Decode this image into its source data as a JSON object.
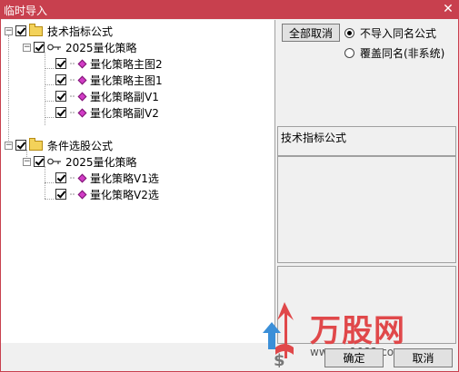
{
  "window": {
    "title": "临时导入",
    "close_glyph": "✕"
  },
  "tree": [
    {
      "id": "n1",
      "label": "技术指标公式",
      "type": "folder",
      "expander": "−",
      "checked": true
    },
    {
      "id": "n1a",
      "label": "2025量化策略",
      "type": "group",
      "expander": "−",
      "checked": true
    },
    {
      "id": "n1a1",
      "label": "量化策略主图2",
      "type": "formula",
      "checked": true
    },
    {
      "id": "n1a2",
      "label": "量化策略主图1",
      "type": "formula",
      "checked": true
    },
    {
      "id": "n1a3",
      "label": "量化策略副V1",
      "type": "formula",
      "checked": true
    },
    {
      "id": "n1a4",
      "label": "量化策略副V2",
      "type": "formula",
      "checked": true
    },
    {
      "id": "n2",
      "label": "条件选股公式",
      "type": "folder",
      "expander": "−",
      "checked": true
    },
    {
      "id": "n2a",
      "label": "2025量化策略",
      "type": "group",
      "expander": "−",
      "checked": true
    },
    {
      "id": "n2a1",
      "label": "量化策略V1选",
      "type": "formula",
      "checked": true
    },
    {
      "id": "n2a2",
      "label": "量化策略V2选",
      "type": "formula",
      "checked": true
    }
  ],
  "right": {
    "cancel_all_label": "全部取消",
    "options": [
      {
        "label": "不导入同名公式",
        "selected": true
      },
      {
        "label": "覆盖同名(非系统)",
        "selected": false
      }
    ],
    "formula_type_label": "技术指标公式"
  },
  "watermark": {
    "logo_text": "万股网",
    "site_text": "www.m1082.com"
  },
  "footer": {
    "confirm_label": "确定",
    "cancel_label": "取消"
  },
  "colors": {
    "titlebar": "#c8404e",
    "checkbox_diamond": "#d23cc6",
    "folder": "#f3d25a",
    "logo": "#e0484a"
  }
}
